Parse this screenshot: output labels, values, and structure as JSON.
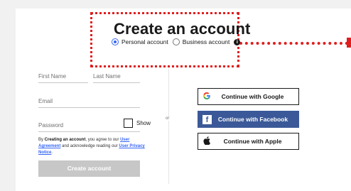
{
  "header": {
    "title": "Create an account",
    "account_types": [
      {
        "label": "Personal account",
        "selected": true
      },
      {
        "label": "Business account",
        "selected": false
      }
    ],
    "info_icon": "info-icon"
  },
  "form": {
    "first_name_placeholder": "First Name",
    "last_name_placeholder": "Last Name",
    "email_placeholder": "Email",
    "password_placeholder": "Password",
    "show_label": "Show",
    "legal": {
      "prefix": "By ",
      "bold": "Creating an account",
      "mid1": ", you agree to our ",
      "link1": "User Agreement",
      "mid2": " and acknowledge reading our ",
      "link2": "User Privacy Notice",
      "suffix": "."
    },
    "submit_label": "Create account"
  },
  "separator": {
    "label": "or"
  },
  "social": [
    {
      "label": "Continue with Google",
      "icon": "google-icon"
    },
    {
      "label": "Continue with Facebook",
      "icon": "facebook-icon"
    },
    {
      "label": "Continue with Apple",
      "icon": "apple-icon"
    }
  ],
  "colors": {
    "accent": "#3665f3",
    "facebook": "#3b5998",
    "callout": "#e01e1e",
    "disabled_button": "#c7c7c7"
  }
}
